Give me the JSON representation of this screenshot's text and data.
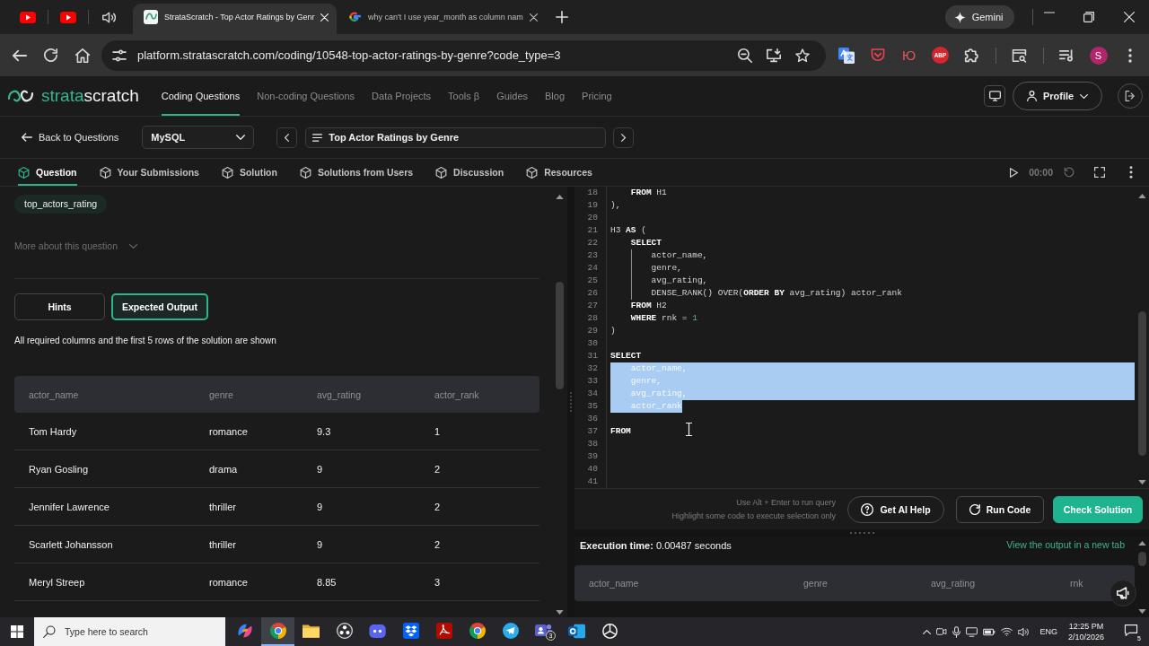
{
  "browser": {
    "tabs": [
      {
        "title": "StrataScratch - Top Actor Ratings by Genr",
        "selected": true
      },
      {
        "title": "why can't I use year_month as column nam",
        "selected": false
      }
    ],
    "gemini": "Gemini",
    "url": "platform.stratascratch.com/coding/10548-top-actor-ratings-by-genre?code_type=3",
    "letter_extension": "Ю",
    "badge_extension": "ABP",
    "profile_initial": "S"
  },
  "site_nav": {
    "logo": [
      {
        "text": "strata",
        "accent": true
      },
      {
        "text": "scratch",
        "accent": false
      }
    ],
    "items": [
      {
        "label": "Coding Questions",
        "selected": true
      },
      {
        "label": "Non-coding Questions",
        "selected": false
      },
      {
        "label": "Data Projects",
        "selected": false
      },
      {
        "label": "Tools β",
        "selected": false
      },
      {
        "label": "Guides",
        "selected": false
      },
      {
        "label": "Blog",
        "selected": false
      },
      {
        "label": "Pricing",
        "selected": false
      }
    ],
    "profile": "Profile"
  },
  "question_bar": {
    "back": "Back to Questions",
    "language": "MySQL",
    "title": "Top Actor Ratings by Genre"
  },
  "panel_tabs": [
    {
      "label": "Question",
      "selected": true
    },
    {
      "label": "Your Submissions",
      "selected": false
    },
    {
      "label": "Solution",
      "selected": false
    },
    {
      "label": "Solutions from Users",
      "selected": false
    },
    {
      "label": "Discussion",
      "selected": false
    },
    {
      "label": "Resources",
      "selected": false
    }
  ],
  "timer": "00:00",
  "question": {
    "table_tag": "top_actors_rating",
    "more": "More about this question",
    "buttons": [
      {
        "label": "Hints",
        "selected": false
      },
      {
        "label": "Expected Output",
        "selected": true
      }
    ],
    "note": "All required columns and the first 5 rows of the solution are shown",
    "table": {
      "columns": [
        "actor_name",
        "genre",
        "avg_rating",
        "actor_rank"
      ],
      "rows": [
        [
          "Tom Hardy",
          "romance",
          "9.3",
          "1"
        ],
        [
          "Ryan Gosling",
          "drama",
          "9",
          "2"
        ],
        [
          "Jennifer Lawrence",
          "thriller",
          "9",
          "2"
        ],
        [
          "Scarlett Johansson",
          "thriller",
          "9",
          "2"
        ],
        [
          "Meryl Streep",
          "romance",
          "8.85",
          "3"
        ]
      ]
    }
  },
  "editor": {
    "lines": [
      {
        "number": "18",
        "segments": [
          {
            "text": "    FROM",
            "kind": "keyword"
          },
          {
            "text": " H1",
            "kind": "plain"
          }
        ],
        "selected": false,
        "indent_guide": false
      },
      {
        "number": "19",
        "segments": [
          {
            "text": "),",
            "kind": "plain"
          }
        ],
        "selected": false,
        "indent_guide": false
      },
      {
        "number": "20",
        "selected": false,
        "indent_guide": false
      },
      {
        "number": "21",
        "segments": [
          {
            "text": "H3 ",
            "kind": "plain"
          },
          {
            "text": "AS",
            "kind": "keyword"
          },
          {
            "text": " (",
            "kind": "plain"
          }
        ],
        "selected": false,
        "indent_guide": false
      },
      {
        "number": "22",
        "segments": [
          {
            "text": "    SELECT",
            "kind": "keyword"
          }
        ],
        "selected": false,
        "indent_guide": false
      },
      {
        "number": "23",
        "segments": [
          {
            "text": "        actor_name,",
            "kind": "plain"
          }
        ],
        "selected": false,
        "indent_guide": true
      },
      {
        "number": "24",
        "segments": [
          {
            "text": "        genre,",
            "kind": "plain"
          }
        ],
        "selected": false,
        "indent_guide": true
      },
      {
        "number": "25",
        "segments": [
          {
            "text": "        avg_rating,",
            "kind": "plain"
          }
        ],
        "selected": false,
        "indent_guide": true
      },
      {
        "number": "26",
        "segments": [
          {
            "text": "        DENSE_RANK() OVER(",
            "kind": "plain"
          },
          {
            "text": "ORDER BY",
            "kind": "keyword"
          },
          {
            "text": " avg_rating) actor_rank",
            "kind": "plain"
          }
        ],
        "selected": false,
        "indent_guide": true
      },
      {
        "number": "27",
        "segments": [
          {
            "text": "    FROM",
            "kind": "keyword"
          },
          {
            "text": " H2",
            "kind": "plain"
          }
        ],
        "selected": false,
        "indent_guide": false
      },
      {
        "number": "28",
        "segments": [
          {
            "text": "    WHERE",
            "kind": "keyword"
          },
          {
            "text": " rnk = ",
            "kind": "plain"
          },
          {
            "text": "1",
            "kind": "number"
          }
        ],
        "selected": false,
        "indent_guide": false
      },
      {
        "number": "29",
        "segments": [
          {
            "text": ")",
            "kind": "plain"
          }
        ],
        "selected": false,
        "indent_guide": false
      },
      {
        "number": "30",
        "selected": false,
        "indent_guide": false
      },
      {
        "number": "31",
        "segments": [
          {
            "text": "SELECT",
            "kind": "keyword"
          }
        ],
        "selected": false,
        "indent_guide": false
      },
      {
        "number": "32",
        "segments": [
          {
            "text": "    actor_name,",
            "kind": "plain"
          }
        ],
        "selected": true,
        "indent_guide": false
      },
      {
        "number": "33",
        "segments": [
          {
            "text": "    genre,",
            "kind": "plain"
          }
        ],
        "selected": true,
        "indent_guide": false
      },
      {
        "number": "34",
        "segments": [
          {
            "text": "    avg_rating,",
            "kind": "plain"
          }
        ],
        "selected": true,
        "indent_guide": false
      },
      {
        "number": "35",
        "segments": [
          {
            "text": "    actor_rank",
            "kind": "plain"
          }
        ],
        "selected": true,
        "indent_guide": false
      },
      {
        "number": "36",
        "selected": false,
        "indent_guide": false
      },
      {
        "number": "37",
        "segments": [
          {
            "text": "FROM",
            "kind": "keyword"
          }
        ],
        "selected": false,
        "indent_guide": false
      },
      {
        "number": "38",
        "selected": false,
        "indent_guide": false
      },
      {
        "number": "39",
        "selected": false,
        "indent_guide": false
      },
      {
        "number": "40",
        "selected": false,
        "indent_guide": false
      },
      {
        "number": "41",
        "selected": false,
        "indent_guide": false
      }
    ],
    "hints": [
      "Use Alt + Enter to run query",
      "Highlight some code to execute selection only"
    ],
    "buttons": [
      {
        "label": "Get AI Help",
        "kind": "help"
      },
      {
        "label": "Run Code",
        "kind": "run"
      },
      {
        "label": "Check Solution",
        "kind": "primary"
      }
    ]
  },
  "output": {
    "execution": "**Execution time:** 0.00487 seconds",
    "link": "View the output in a new tab",
    "columns": [
      "actor_name",
      "genre",
      "avg_rating",
      "rnk"
    ]
  },
  "taskbar": {
    "search_placeholder": "Type here to search",
    "apps": [
      {
        "kind": "swirl",
        "selected": false
      },
      {
        "kind": "browser",
        "selected": true
      },
      {
        "kind": "folder",
        "selected": false
      },
      {
        "kind": "record",
        "selected": false
      },
      {
        "kind": "chat",
        "selected": false
      },
      {
        "kind": "box",
        "selected": false
      },
      {
        "kind": "pdf",
        "selected": false
      },
      {
        "kind": "browser",
        "selected": false
      },
      {
        "kind": "plane",
        "selected": false
      },
      {
        "kind": "team",
        "selected": false,
        "badge": "3"
      },
      {
        "kind": "mail",
        "selected": false
      },
      {
        "kind": "knot",
        "selected": false
      }
    ],
    "language": "ENG",
    "time": "12:25 PM",
    "date": "2/10/2026",
    "notifications": "5"
  }
}
